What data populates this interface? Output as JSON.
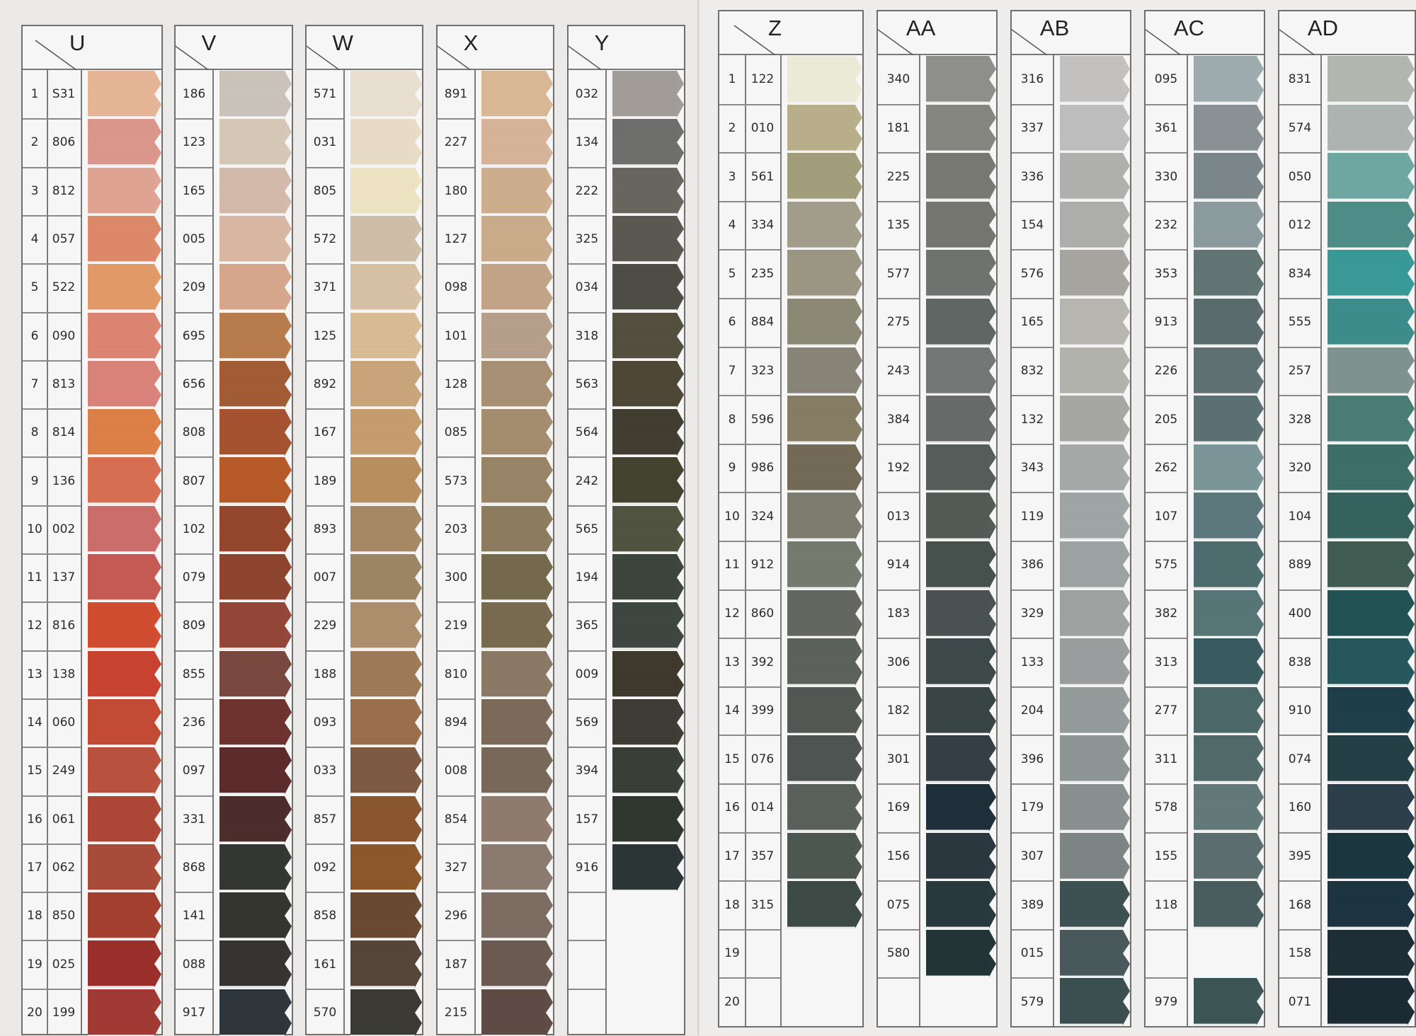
{
  "columns": [
    {
      "letter": "U",
      "with_row_numbers": true,
      "rows": [
        {
          "num": "1",
          "code": "S31",
          "color": "#e6b597"
        },
        {
          "num": "2",
          "code": "806",
          "color": "#dc978c"
        },
        {
          "num": "3",
          "code": "812",
          "color": "#e0a493"
        },
        {
          "num": "4",
          "code": "057",
          "color": "#dd8a6a"
        },
        {
          "num": "5",
          "code": "522",
          "color": "#e19a68"
        },
        {
          "num": "6",
          "code": "090",
          "color": "#dc8572"
        },
        {
          "num": "7",
          "code": "813",
          "color": "#d9837b"
        },
        {
          "num": "8",
          "code": "814",
          "color": "#dc8048"
        },
        {
          "num": "9",
          "code": "136",
          "color": "#d76f53"
        },
        {
          "num": "10",
          "code": "002",
          "color": "#cc6e6a"
        },
        {
          "num": "11",
          "code": "137",
          "color": "#c65a55"
        },
        {
          "num": "12",
          "code": "816",
          "color": "#d14d32"
        },
        {
          "num": "13",
          "code": "138",
          "color": "#c94331"
        },
        {
          "num": "14",
          "code": "060",
          "color": "#c34b35"
        },
        {
          "num": "15",
          "code": "249",
          "color": "#b9523f"
        },
        {
          "num": "16",
          "code": "061",
          "color": "#ad4737"
        },
        {
          "num": "17",
          "code": "062",
          "color": "#a94c3c"
        },
        {
          "num": "18",
          "code": "850",
          "color": "#a3402f"
        },
        {
          "num": "19",
          "code": "025",
          "color": "#9a2f2b"
        },
        {
          "num": "20",
          "code": "199",
          "color": "#a23a36"
        }
      ]
    },
    {
      "letter": "V",
      "with_row_numbers": false,
      "rows": [
        {
          "code": "186",
          "color": "#cbc3bb"
        },
        {
          "code": "123",
          "color": "#d6c8b6"
        },
        {
          "code": "165",
          "color": "#d3baab"
        },
        {
          "code": "005",
          "color": "#d9b7a3"
        },
        {
          "code": "209",
          "color": "#d6a68d"
        },
        {
          "code": "695",
          "color": "#b97c4c"
        },
        {
          "code": "656",
          "color": "#a15c36"
        },
        {
          "code": "808",
          "color": "#a65331"
        },
        {
          "code": "807",
          "color": "#b75a2a"
        },
        {
          "code": "102",
          "color": "#94472d"
        },
        {
          "code": "079",
          "color": "#8d4530"
        },
        {
          "code": "809",
          "color": "#944638"
        },
        {
          "code": "855",
          "color": "#79483f"
        },
        {
          "code": "236",
          "color": "#6f3430"
        },
        {
          "code": "097",
          "color": "#5c2c2c"
        },
        {
          "code": "331",
          "color": "#4e2e2c"
        },
        {
          "code": "868",
          "color": "#353733"
        },
        {
          "code": "141",
          "color": "#353630"
        },
        {
          "code": "088",
          "color": "#363531"
        },
        {
          "code": "917",
          "color": "#30373c"
        }
      ]
    },
    {
      "letter": "W",
      "with_row_numbers": false,
      "rows": [
        {
          "code": "571",
          "color": "#e8dfd0"
        },
        {
          "code": "031",
          "color": "#e8dcc6"
        },
        {
          "code": "805",
          "color": "#ede3c2"
        },
        {
          "code": "572",
          "color": "#cfbea8"
        },
        {
          "code": "371",
          "color": "#d7c1a4"
        },
        {
          "code": "125",
          "color": "#d8bc96"
        },
        {
          "code": "892",
          "color": "#c9a57b"
        },
        {
          "code": "167",
          "color": "#c59d6f"
        },
        {
          "code": "189",
          "color": "#b98f5f"
        },
        {
          "code": "893",
          "color": "#a68a66"
        },
        {
          "code": "007",
          "color": "#9c8664"
        },
        {
          "code": "229",
          "color": "#ad8f6d"
        },
        {
          "code": "188",
          "color": "#9f7a59"
        },
        {
          "code": "093",
          "color": "#9a6f4c"
        },
        {
          "code": "033",
          "color": "#7d5a41"
        },
        {
          "code": "857",
          "color": "#8a5730"
        },
        {
          "code": "092",
          "color": "#8e582d"
        },
        {
          "code": "858",
          "color": "#6a4a30"
        },
        {
          "code": "161",
          "color": "#56463a"
        },
        {
          "code": "570",
          "color": "#3c3a35"
        }
      ]
    },
    {
      "letter": "X",
      "with_row_numbers": false,
      "rows": [
        {
          "code": "891",
          "color": "#d9b995"
        },
        {
          "code": "227",
          "color": "#d6b49a"
        },
        {
          "code": "180",
          "color": "#cdae8e"
        },
        {
          "code": "127",
          "color": "#c9ac8b"
        },
        {
          "code": "098",
          "color": "#c2a588"
        },
        {
          "code": "101",
          "color": "#b7a08b"
        },
        {
          "code": "128",
          "color": "#a89173"
        },
        {
          "code": "085",
          "color": "#a58e6f"
        },
        {
          "code": "573",
          "color": "#988466"
        },
        {
          "code": "203",
          "color": "#8d7c5d"
        },
        {
          "code": "300",
          "color": "#75694e"
        },
        {
          "code": "219",
          "color": "#786b50"
        },
        {
          "code": "810",
          "color": "#8b7a66"
        },
        {
          "code": "894",
          "color": "#7c6b59"
        },
        {
          "code": "008",
          "color": "#79695a"
        },
        {
          "code": "854",
          "color": "#907c6e"
        },
        {
          "code": "327",
          "color": "#8b7b70"
        },
        {
          "code": "296",
          "color": "#7d6d63"
        },
        {
          "code": "187",
          "color": "#6b5b52"
        },
        {
          "code": "215",
          "color": "#5e4c45"
        }
      ]
    },
    {
      "letter": "Y",
      "with_row_numbers": false,
      "rows": [
        {
          "code": "032",
          "color": "#a19d98"
        },
        {
          "code": "134",
          "color": "#6f6f6d"
        },
        {
          "code": "222",
          "color": "#696660"
        },
        {
          "code": "325",
          "color": "#5c5852"
        },
        {
          "code": "034",
          "color": "#4e4e46"
        },
        {
          "code": "318",
          "color": "#54503f"
        },
        {
          "code": "563",
          "color": "#4f4836"
        },
        {
          "code": "564",
          "color": "#433e32"
        },
        {
          "code": "242",
          "color": "#44432f"
        },
        {
          "code": "565",
          "color": "#515440"
        },
        {
          "code": "194",
          "color": "#3c463d"
        },
        {
          "code": "365",
          "color": "#3e4742"
        },
        {
          "code": "009",
          "color": "#40392e"
        },
        {
          "code": "569",
          "color": "#3f3d35"
        },
        {
          "code": "394",
          "color": "#3a3f37"
        },
        {
          "code": "157",
          "color": "#303830"
        },
        {
          "code": "916",
          "color": "#2c3637"
        },
        {
          "code": "",
          "color": ""
        },
        {
          "code": "",
          "color": ""
        },
        {
          "code": "",
          "color": ""
        }
      ]
    },
    {
      "letter": "Z",
      "with_row_numbers": true,
      "rows": [
        {
          "num": "1",
          "code": "122",
          "color": "#ecebd8"
        },
        {
          "num": "2",
          "code": "010",
          "color": "#b9b08b"
        },
        {
          "num": "3",
          "code": "561",
          "color": "#a29e7c"
        },
        {
          "num": "4",
          "code": "334",
          "color": "#a39e8c"
        },
        {
          "num": "5",
          "code": "235",
          "color": "#9b9784"
        },
        {
          "num": "6",
          "code": "884",
          "color": "#8c8a76"
        },
        {
          "num": "7",
          "code": "323",
          "color": "#878477"
        },
        {
          "num": "8",
          "code": "596",
          "color": "#867d64"
        },
        {
          "num": "9",
          "code": "986",
          "color": "#736b58"
        },
        {
          "num": "10",
          "code": "324",
          "color": "#7f7c70"
        },
        {
          "num": "11",
          "code": "912",
          "color": "#767b70"
        },
        {
          "num": "12",
          "code": "860",
          "color": "#656860"
        },
        {
          "num": "13",
          "code": "392",
          "color": "#5e625c"
        },
        {
          "num": "14",
          "code": "399",
          "color": "#535854"
        },
        {
          "num": "15",
          "code": "076",
          "color": "#4f5553"
        },
        {
          "num": "16",
          "code": "014",
          "color": "#5b625d"
        },
        {
          "num": "17",
          "code": "357",
          "color": "#4d5852"
        },
        {
          "num": "18",
          "code": "315",
          "color": "#3d4a45"
        },
        {
          "num": "19",
          "code": "",
          "color": ""
        },
        {
          "num": "20",
          "code": "",
          "color": ""
        }
      ]
    },
    {
      "letter": "AA",
      "with_row_numbers": false,
      "rows": [
        {
          "code": "340",
          "color": "#8f8f8b"
        },
        {
          "code": "181",
          "color": "#858680"
        },
        {
          "code": "225",
          "color": "#787a72"
        },
        {
          "code": "135",
          "color": "#74766f"
        },
        {
          "code": "577",
          "color": "#6f7470"
        },
        {
          "code": "275",
          "color": "#5f6864"
        },
        {
          "code": "243",
          "color": "#737876"
        },
        {
          "code": "384",
          "color": "#686b6a"
        },
        {
          "code": "192",
          "color": "#555e5b"
        },
        {
          "code": "013",
          "color": "#545c58"
        },
        {
          "code": "914",
          "color": "#47524f"
        },
        {
          "code": "183",
          "color": "#4a5352"
        },
        {
          "code": "306",
          "color": "#3e4949"
        },
        {
          "code": "182",
          "color": "#3a4646"
        },
        {
          "code": "301",
          "color": "#344045"
        },
        {
          "code": "169",
          "color": "#20303a"
        },
        {
          "code": "156",
          "color": "#2b3840"
        },
        {
          "code": "075",
          "color": "#283a3e"
        },
        {
          "code": "580",
          "color": "#243538"
        },
        {
          "code": "",
          "color": ""
        }
      ]
    },
    {
      "letter": "AB",
      "with_row_numbers": false,
      "rows": [
        {
          "code": "316",
          "color": "#c3c2c1"
        },
        {
          "code": "337",
          "color": "#bebebe"
        },
        {
          "code": "336",
          "color": "#b0b0ae"
        },
        {
          "code": "154",
          "color": "#aeaeac"
        },
        {
          "code": "576",
          "color": "#a6a59f"
        },
        {
          "code": "165",
          "color": "#b8b6b1"
        },
        {
          "code": "832",
          "color": "#b3b3ad"
        },
        {
          "code": "132",
          "color": "#a7a8a3"
        },
        {
          "code": "343",
          "color": "#a5aaa8"
        },
        {
          "code": "119",
          "color": "#a0a6a5"
        },
        {
          "code": "386",
          "color": "#9da3a3"
        },
        {
          "code": "329",
          "color": "#9ea3a2"
        },
        {
          "code": "133",
          "color": "#9b9e9e"
        },
        {
          "code": "204",
          "color": "#949b9b"
        },
        {
          "code": "396",
          "color": "#8e9595"
        },
        {
          "code": "179",
          "color": "#8a9090"
        },
        {
          "code": "307",
          "color": "#7d8585"
        },
        {
          "code": "389",
          "color": "#3e5254"
        },
        {
          "code": "015",
          "color": "#4a5a5c"
        },
        {
          "code": "579",
          "color": "#3c5052"
        }
      ]
    },
    {
      "letter": "AC",
      "with_row_numbers": false,
      "rows": [
        {
          "code": "095",
          "color": "#9eacb0"
        },
        {
          "code": "361",
          "color": "#8a9296"
        },
        {
          "code": "330",
          "color": "#7b878b"
        },
        {
          "code": "232",
          "color": "#8c9c9e"
        },
        {
          "code": "353",
          "color": "#637474"
        },
        {
          "code": "913",
          "color": "#5b6c6e"
        },
        {
          "code": "226",
          "color": "#5f7173"
        },
        {
          "code": "205",
          "color": "#5b7173"
        },
        {
          "code": "262",
          "color": "#7c9599"
        },
        {
          "code": "107",
          "color": "#5c787c"
        },
        {
          "code": "575",
          "color": "#4e6d70"
        },
        {
          "code": "382",
          "color": "#587577"
        },
        {
          "code": "313",
          "color": "#3a5b5f"
        },
        {
          "code": "277",
          "color": "#4d6869"
        },
        {
          "code": "311",
          "color": "#526a6a"
        },
        {
          "code": "578",
          "color": "#64797a"
        },
        {
          "code": "155",
          "color": "#5c6d6f"
        },
        {
          "code": "118",
          "color": "#4a5e60"
        },
        {
          "code": "",
          "color": ""
        },
        {
          "code": "979",
          "color": "#3e5556"
        }
      ]
    },
    {
      "letter": "AD",
      "with_row_numbers": false,
      "rows": [
        {
          "code": "831",
          "color": "#b3b7b0"
        },
        {
          "code": "574",
          "color": "#aeb4b2"
        },
        {
          "code": "050",
          "color": "#6fa7a2"
        },
        {
          "code": "012",
          "color": "#4f8d89"
        },
        {
          "code": "834",
          "color": "#3a9a98"
        },
        {
          "code": "555",
          "color": "#3c8d8b"
        },
        {
          "code": "257",
          "color": "#7f9490"
        },
        {
          "code": "328",
          "color": "#4b7d77"
        },
        {
          "code": "320",
          "color": "#3f6f69"
        },
        {
          "code": "104",
          "color": "#35625f"
        },
        {
          "code": "889",
          "color": "#415c52"
        },
        {
          "code": "400",
          "color": "#245356"
        },
        {
          "code": "838",
          "color": "#27585c"
        },
        {
          "code": "910",
          "color": "#1f3f4a"
        },
        {
          "code": "074",
          "color": "#253f47"
        },
        {
          "code": "160",
          "color": "#2d3f4b"
        },
        {
          "code": "395",
          "color": "#1d3740"
        },
        {
          "code": "168",
          "color": "#1c3540"
        },
        {
          "code": "158",
          "color": "#1f2f38"
        },
        {
          "code": "071",
          "color": "#1c2b34"
        }
      ]
    }
  ]
}
